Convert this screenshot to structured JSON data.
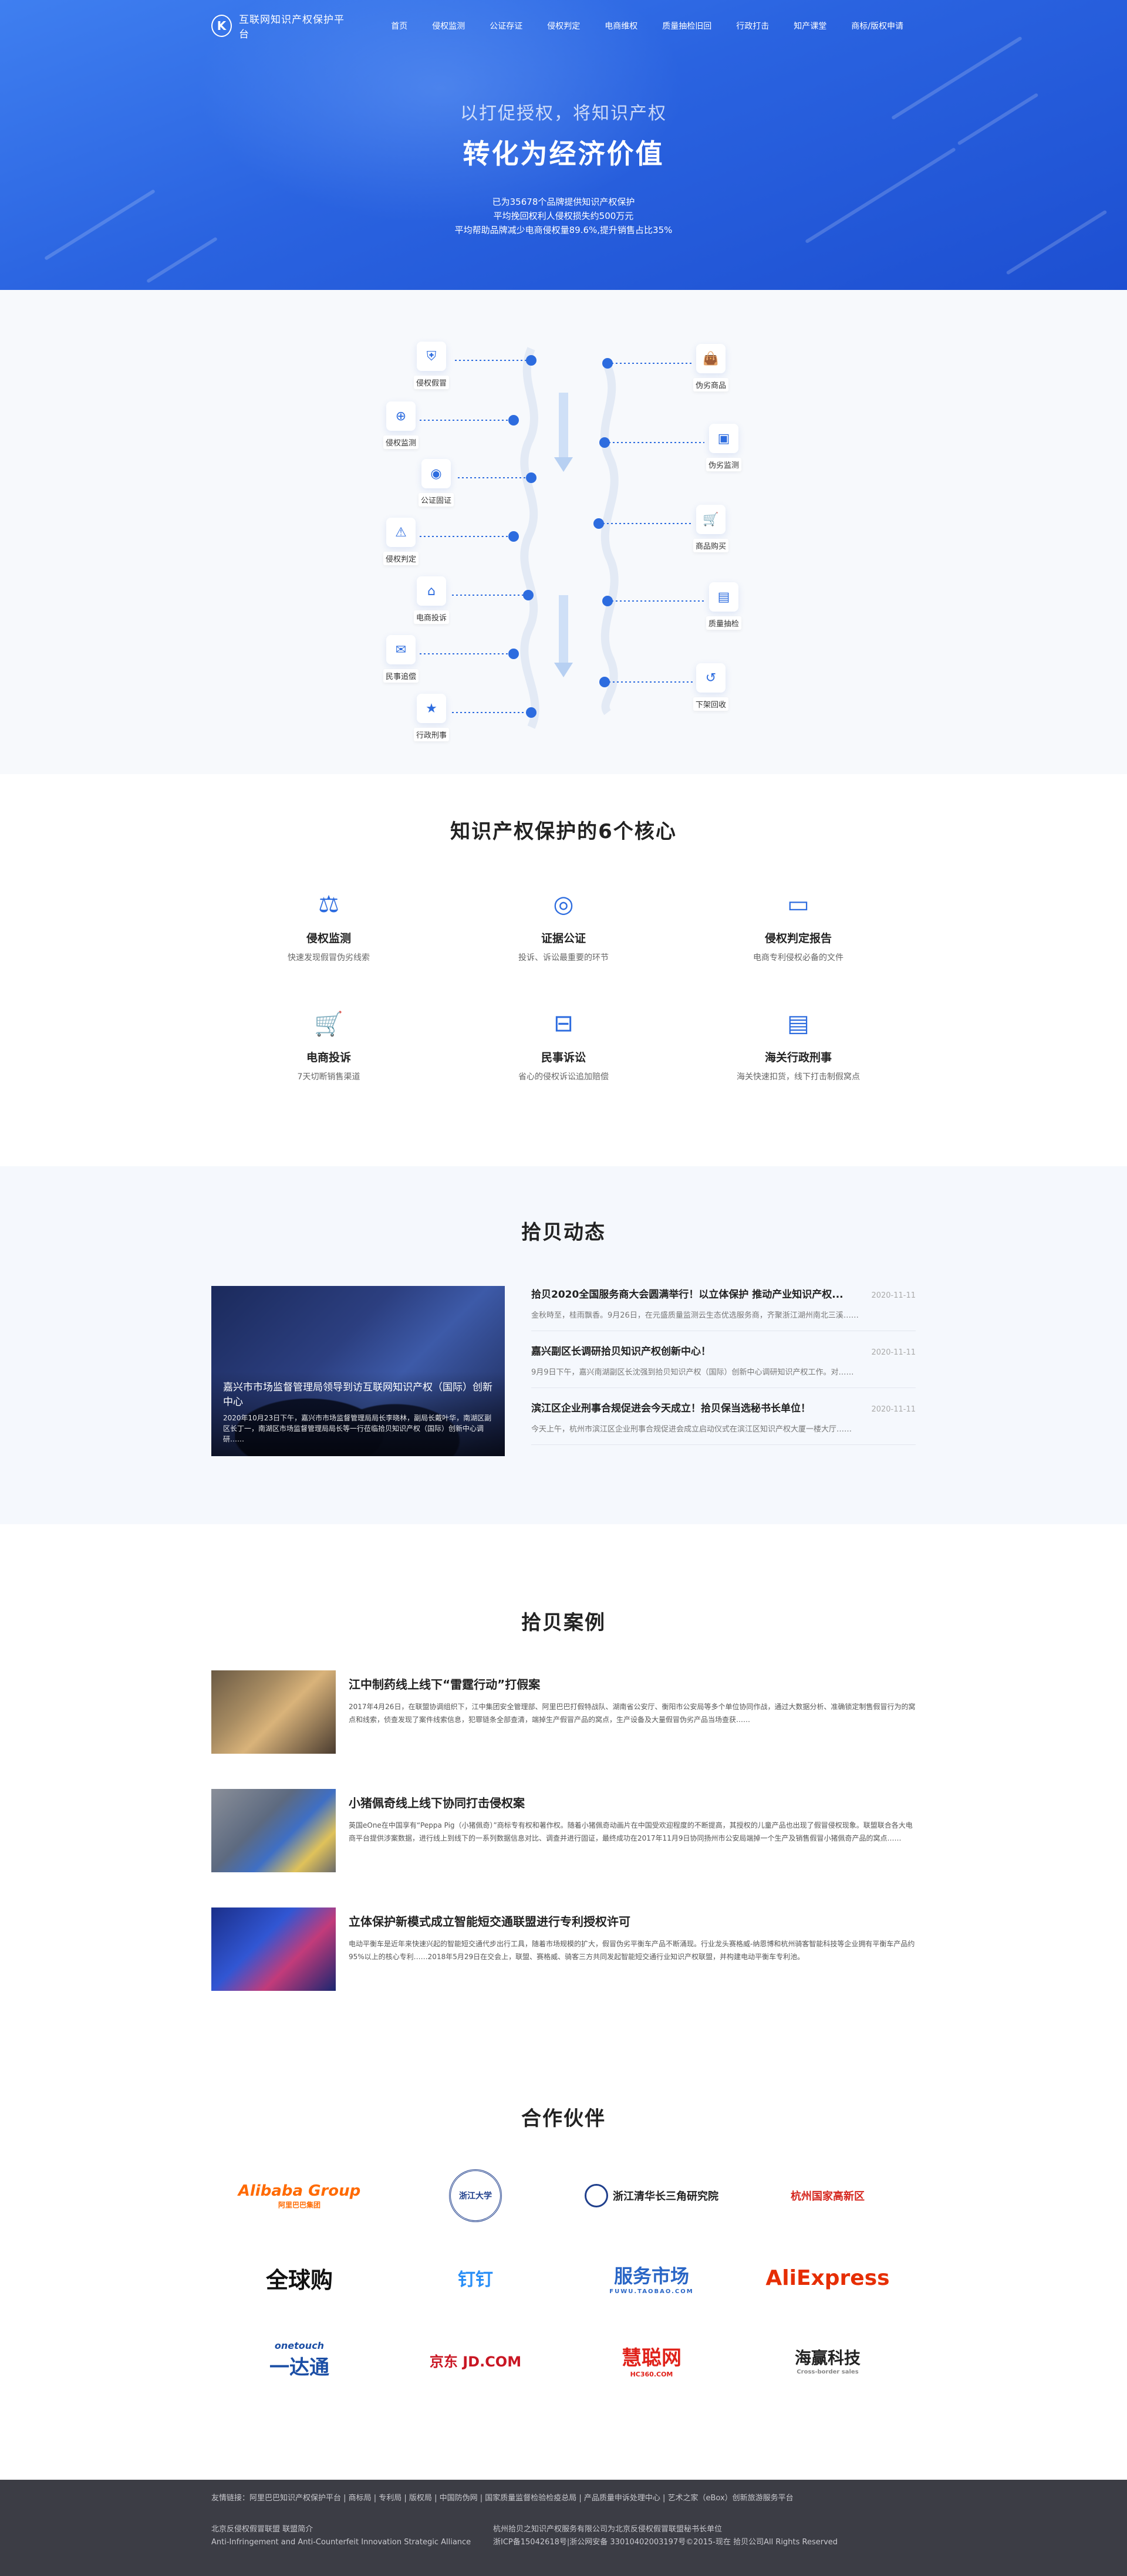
{
  "nav": {
    "brand": "互联网知识产权保护平台",
    "logo_letter": "K",
    "items": [
      "首页",
      "侵权监测",
      "公证存证",
      "侵权判定",
      "电商维权",
      "质量抽检旧回",
      "行政打击",
      "知产课堂",
      "商标/版权申请"
    ]
  },
  "hero": {
    "subtitle": "以打促授权，将知识产权",
    "title": "转化为经济价值",
    "lines": [
      "已为35678个品牌提供知识产权保护",
      "平均挽回权利人侵权损失约500万元",
      "平均帮助品牌减少电商侵权量89.6%,提升销售占比35%"
    ]
  },
  "flow": {
    "left": [
      "侵权假冒",
      "侵权监测",
      "公证固证",
      "侵权判定",
      "电商投诉",
      "民事追偿",
      "行政刑事"
    ],
    "right": [
      "伪劣商品",
      "伪劣监测",
      "商品购买",
      "质量抽检",
      "下架回收"
    ],
    "colors": {
      "line": "#2d6cdf",
      "arrow": "#cfe0f7"
    }
  },
  "core": {
    "title": "知识产权保护的6个核心",
    "items": [
      {
        "icon": "scale-icon",
        "glyph": "⚖",
        "title": "侵权监测",
        "desc": "快速发现假冒伪劣线索"
      },
      {
        "icon": "globe-icon",
        "glyph": "◎",
        "title": "证据公证",
        "desc": "投诉、诉讼最重要的环节"
      },
      {
        "icon": "monitor-icon",
        "glyph": "▭",
        "title": "侵权判定报告",
        "desc": "电商专利侵权必备的文件"
      },
      {
        "icon": "cart-icon",
        "glyph": "🛒",
        "title": "电商投诉",
        "desc": "7天切断销售渠道"
      },
      {
        "icon": "box-icon",
        "glyph": "⊟",
        "title": "民事诉讼",
        "desc": "省心的侵权诉讼追加赔偿"
      },
      {
        "icon": "document-icon",
        "glyph": "▤",
        "title": "海关行政刑事",
        "desc": "海关快速扣货，线下打击制假窝点"
      }
    ]
  },
  "news": {
    "title": "拾贝动态",
    "featured": {
      "headline": "嘉兴市市场监督管理局领导到访互联网知识产权（国际）创新中心",
      "summary": "2020年10月23日下午，嘉兴市市场监督管理局局长李晓林，副局长戴叶华，南湖区副区长丁一，南湖区市场监督管理局局长等一行莅临拾贝知识产权（国际）创新中心调研……"
    },
    "items": [
      {
        "title": "拾贝2020全国服务商大会圆满举行！以立体保护 推动产业知识产权...",
        "date": "2020-11-11",
        "summary": "金秋時至，桂雨飘香。9月26日，在元盛质量监测云生态优选服务商，齐聚浙江湖州南北三溪……"
      },
      {
        "title": "嘉兴副区长调研拾贝知识产权创新中心！",
        "date": "2020-11-11",
        "summary": "9月9日下午，嘉兴南湖副区长沈强到拾贝知识产权（国际）创新中心调研知识产权工作。对……"
      },
      {
        "title": "滨江区企业刑事合规促进会今天成立！拾贝保当选秘书长单位！",
        "date": "2020-11-11",
        "summary": "今天上午，杭州市滨江区企业刑事合规促进会成立启动仪式在滨江区知识产权大厦一楼大厅……"
      }
    ]
  },
  "cases": {
    "title": "拾贝案例",
    "items": [
      {
        "title": "江中制药线上线下“雷霆行动”打假案",
        "body": "2017年4月26日，在联盟协调组织下，江中集团安全管理部、阿里巴巴打假特战队、湖南省公安厅、衡阳市公安局等多个单位协同作战，通过大数据分析、准确锁定制售假冒行为的窝点和线索，侦查发现了案件线索信息，犯罪链条全部查清，端掉生产假冒产品的窝点，生产设备及大量假冒伪劣产品当场查获……"
      },
      {
        "title": "小猪佩奇线上线下协同打击侵权案",
        "body": "英国eOne在中国享有“Peppa Pig（小猪佩奇）”商标专有权和著作权。随着小猪佩奇动画片在中国受欢迎程度的不断提高，其授权的儿童产品也出现了假冒侵权现象。联盟联合各大电商平台提供涉案数据，进行线上到线下的一系列数据信息对比、调查并进行固证，最终成功在2017年11月9日协同扬州市公安局端掉一个生产及销售假冒小猪佩奇产品的窝点……"
      },
      {
        "title": "立体保护新模式成立智能短交通联盟进行专利授权许可",
        "body": "电动平衡车是近年来快速兴起的智能短交通代步出行工具，随着市场规模的扩大，假冒伪劣平衡车产品不断涌现。行业龙头赛格威-纳恩博和杭州骑客智能科技等企业拥有平衡车产品约95%以上的核心专利……2018年5月29日在交会上，联盟、赛格威、骑客三方共同发起智能短交通行业知识产权联盟，并构建电动平衡车专利池。"
      }
    ]
  },
  "partners": {
    "title": "合作伙伴",
    "items": [
      {
        "name": "Alibaba Group",
        "sub": "阿里巴巴集团",
        "color": "#ff6a00"
      },
      {
        "name": "浙江大学",
        "sub": "",
        "color": "#1f3f8c"
      },
      {
        "name": "浙江清华长三角研究院",
        "sub": "",
        "color": "#222222"
      },
      {
        "name": "杭州国家高新区",
        "sub": "",
        "color": "#d5261e"
      },
      {
        "name": "全球购",
        "sub": "",
        "color": "#111111"
      },
      {
        "name": "钉钉",
        "sub": "",
        "color": "#2a8ff7"
      },
      {
        "name": "服务市场",
        "sub": "FUWU.TAOBAO.COM",
        "color": "#2a66c6"
      },
      {
        "name": "AliExpress",
        "sub": "",
        "color": "#e62e04"
      },
      {
        "name": "一达通",
        "sub": "onetouch",
        "color": "#1b4ea5"
      },
      {
        "name": "京东 JD.COM",
        "sub": "",
        "color": "#c91623"
      },
      {
        "name": "慧聪网",
        "sub": "HC360.COM",
        "color": "#e0221a"
      },
      {
        "name": "海赢科技",
        "sub": "Cross-border sales",
        "color": "#222222"
      }
    ]
  },
  "footer": {
    "links": "友情链接：阿里巴巴知识产权保护平台 | 商标局 | 专利局 | 版权局 | 中国防伪网 | 国家质量监督检验检疫总局 | 产品质量申诉处理中心 | 艺术之家（eBox）创新旅游服务平台",
    "left1": "北京反侵权假冒联盟 联盟简介",
    "left2": "Anti-Infringement and Anti-Counterfeit Innovation Strategic Alliance",
    "right1": "杭州拾贝之知识产权服务有限公司为北京反侵权假冒联盟秘书长单位",
    "right2": "浙ICP备15042618号|浙公网安备 33010402003197号©2015-现在 拾贝公司All Rights Reserved"
  }
}
